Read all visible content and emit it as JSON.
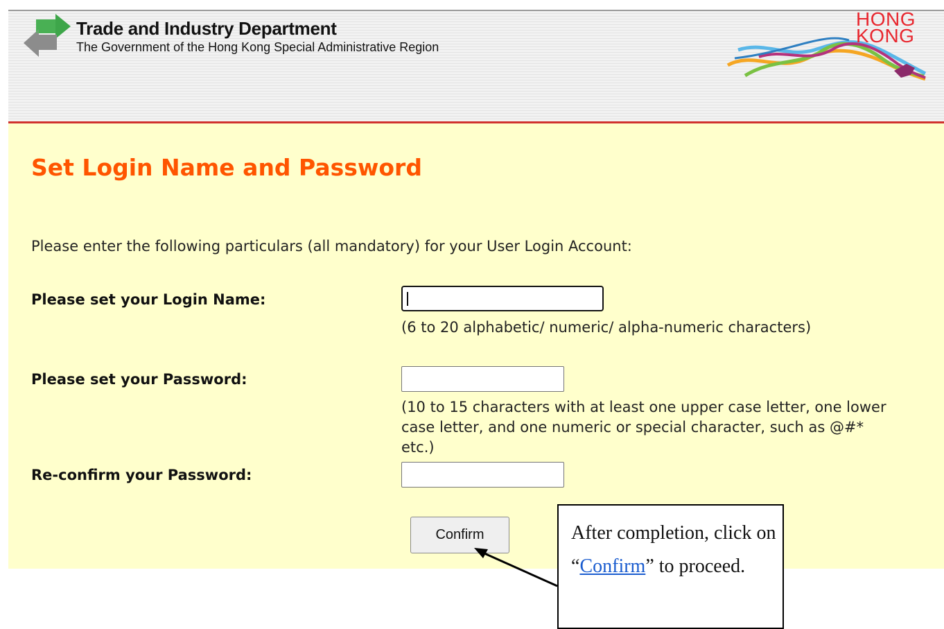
{
  "header": {
    "department_name": "Trade and Industry Department",
    "government_name": "The Government of the Hong Kong Special Administrative Region",
    "brand_word1": "HONG",
    "brand_word2": "KONG",
    "logo_icon": "tid-arrows-logo",
    "brand_icon": "brand-hong-kong-dragon-logo"
  },
  "page": {
    "title": "Set Login Name and Password",
    "intro": "Please enter the following particulars (all mandatory) for your User Login Account:"
  },
  "form": {
    "login_label": "Please set your Login Name:",
    "login_value": "",
    "login_hint": "(6 to 20 alphabetic/ numeric/ alpha-numeric characters)",
    "password_label": "Please set your Password:",
    "password_value": "",
    "password_hint": "(10 to 15 characters with at least one upper case letter, one lower case letter, and one numeric or special character, such as @#* etc.)",
    "reconfirm_label": "Re-confirm your Password:",
    "reconfirm_value": "",
    "confirm_label": "Confirm"
  },
  "callout": {
    "text_before": "After completion, click on “",
    "link_text": "Confirm",
    "text_after": "” to proceed."
  },
  "colors": {
    "title": "#ff5500",
    "content_background": "#ffffcc",
    "header_rule": "#d0322e",
    "link": "#1a5ccf"
  }
}
